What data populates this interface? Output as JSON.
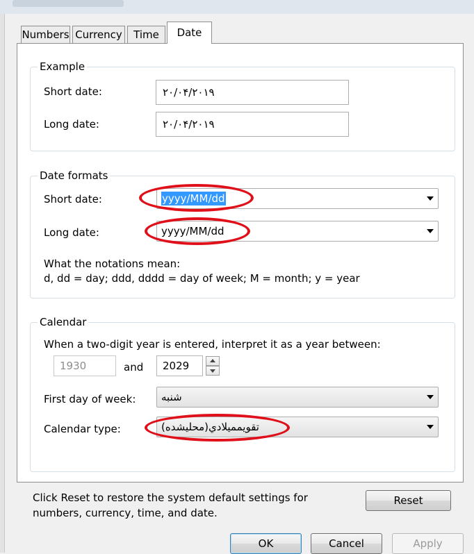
{
  "tabs": [
    {
      "label": "Numbers"
    },
    {
      "label": "Currency"
    },
    {
      "label": "Time"
    },
    {
      "label": "Date"
    }
  ],
  "example": {
    "title": "Example",
    "short_date_label": "Short date:",
    "short_date_value": "۲۰/۰۴/۲۰۱۹",
    "long_date_label": "Long date:",
    "long_date_value": "۲۰/۰۴/۲۰۱۹"
  },
  "date_formats": {
    "title": "Date formats",
    "short_date_label": "Short date:",
    "short_date_value": "yyyy/MM/dd",
    "long_date_label": "Long date:",
    "long_date_value": "yyyy/MM/dd",
    "notations_title": "What the notations mean:",
    "notations_text": "d, dd = day;  ddd, dddd = day of week;  M = month;  y = year"
  },
  "calendar": {
    "title": "Calendar",
    "two_digit_text": "When a two-digit year is entered, interpret it as a year between:",
    "year_from": "1930",
    "and_label": "and",
    "year_to": "2029",
    "first_day_label": "First day of week:",
    "first_day_value": "شنبه",
    "calendar_type_label": "Calendar type:",
    "calendar_type_value": "تقويممیلادي(محلیشده)"
  },
  "reset": {
    "text": "Click Reset to restore the system default settings for numbers, currency, time, and date.",
    "button_label": "Reset"
  },
  "dialog_buttons": {
    "ok": "OK",
    "cancel": "Cancel",
    "apply": "Apply"
  },
  "colors": {
    "highlight_circle": "#e0101a",
    "selection": "#3399ff"
  }
}
